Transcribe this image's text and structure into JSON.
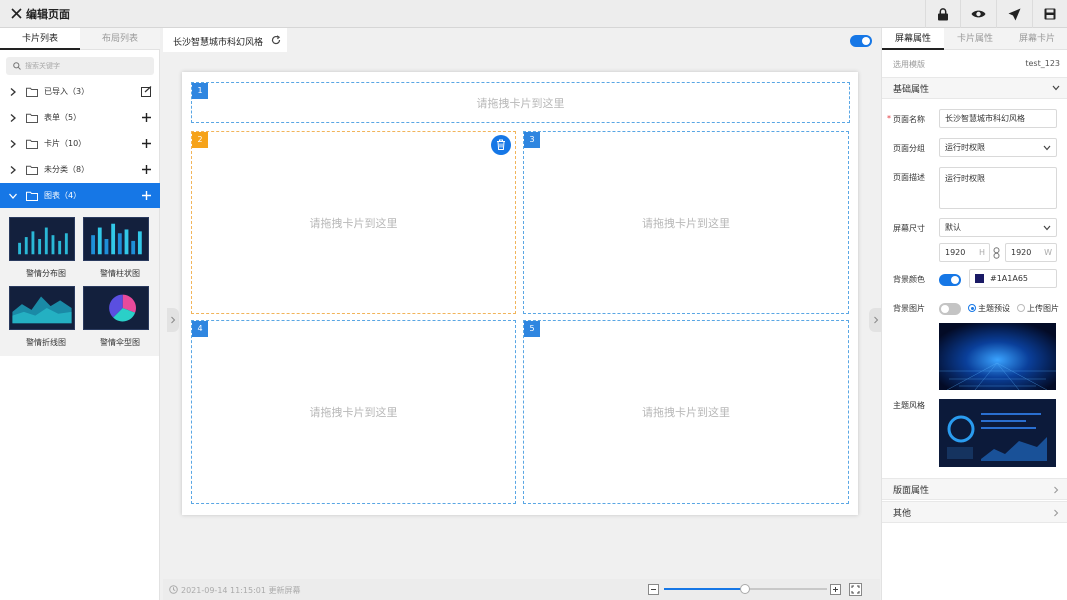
{
  "header": {
    "title": "编辑页面"
  },
  "left_panel": {
    "tabs": [
      "卡片列表",
      "布局列表"
    ],
    "search_placeholder": "搜索关键字",
    "tree": [
      {
        "label": "已导入（3）",
        "action": "import-icon"
      },
      {
        "label": "表单（5）",
        "action": "plus-icon"
      },
      {
        "label": "卡片（10）",
        "action": "plus-icon"
      },
      {
        "label": "未分类（8）",
        "action": "plus-icon"
      },
      {
        "label": "图表（4）",
        "action": "plus-icon",
        "selected": true
      }
    ],
    "thumbnails": [
      "警情分布图",
      "警情柱状图",
      "警情折线图",
      "警情伞型图"
    ]
  },
  "canvas": {
    "tab_title": "长沙智慧城市科幻风格",
    "slots": [
      {
        "num": "1",
        "placeholder": "请拖拽卡片到这里"
      },
      {
        "num": "2",
        "placeholder": "请拖拽卡片到这里"
      },
      {
        "num": "3",
        "placeholder": "请拖拽卡片到这里"
      },
      {
        "num": "4",
        "placeholder": "请拖拽卡片到这里"
      },
      {
        "num": "5",
        "placeholder": "请拖拽卡片到这里"
      }
    ],
    "status_text": "2021-09-14 11:15:01 更新屏幕"
  },
  "right_panel": {
    "tabs": [
      "屏幕属性",
      "卡片属性",
      "屏幕卡片"
    ],
    "template_label": "选用模版",
    "template_value": "test_123",
    "basic_section": "基础属性",
    "page_name_label": "页面名称",
    "page_name_value": "长沙智慧城市科幻风格",
    "page_group_label": "页面分组",
    "page_group_value": "运行时权限",
    "page_desc_label": "页面描述",
    "page_desc_value": "运行时权限",
    "screen_size_label": "屏幕尺寸",
    "screen_size_value": "默认",
    "height_value": "1920",
    "height_unit": "H",
    "width_value": "1920",
    "width_unit": "W",
    "bg_color_label": "背景颜色",
    "bg_color_value": "#1A1A65",
    "bg_image_label": "背景图片",
    "radio_preset": "主题预设",
    "radio_upload": "上传图片",
    "theme_style_label": "主题风格",
    "layout_section": "版面属性",
    "other_section": "其他"
  },
  "colors": {
    "accent": "#1677e6",
    "selected_slot": "#f6a31a",
    "swatch": "#1A1A65"
  }
}
